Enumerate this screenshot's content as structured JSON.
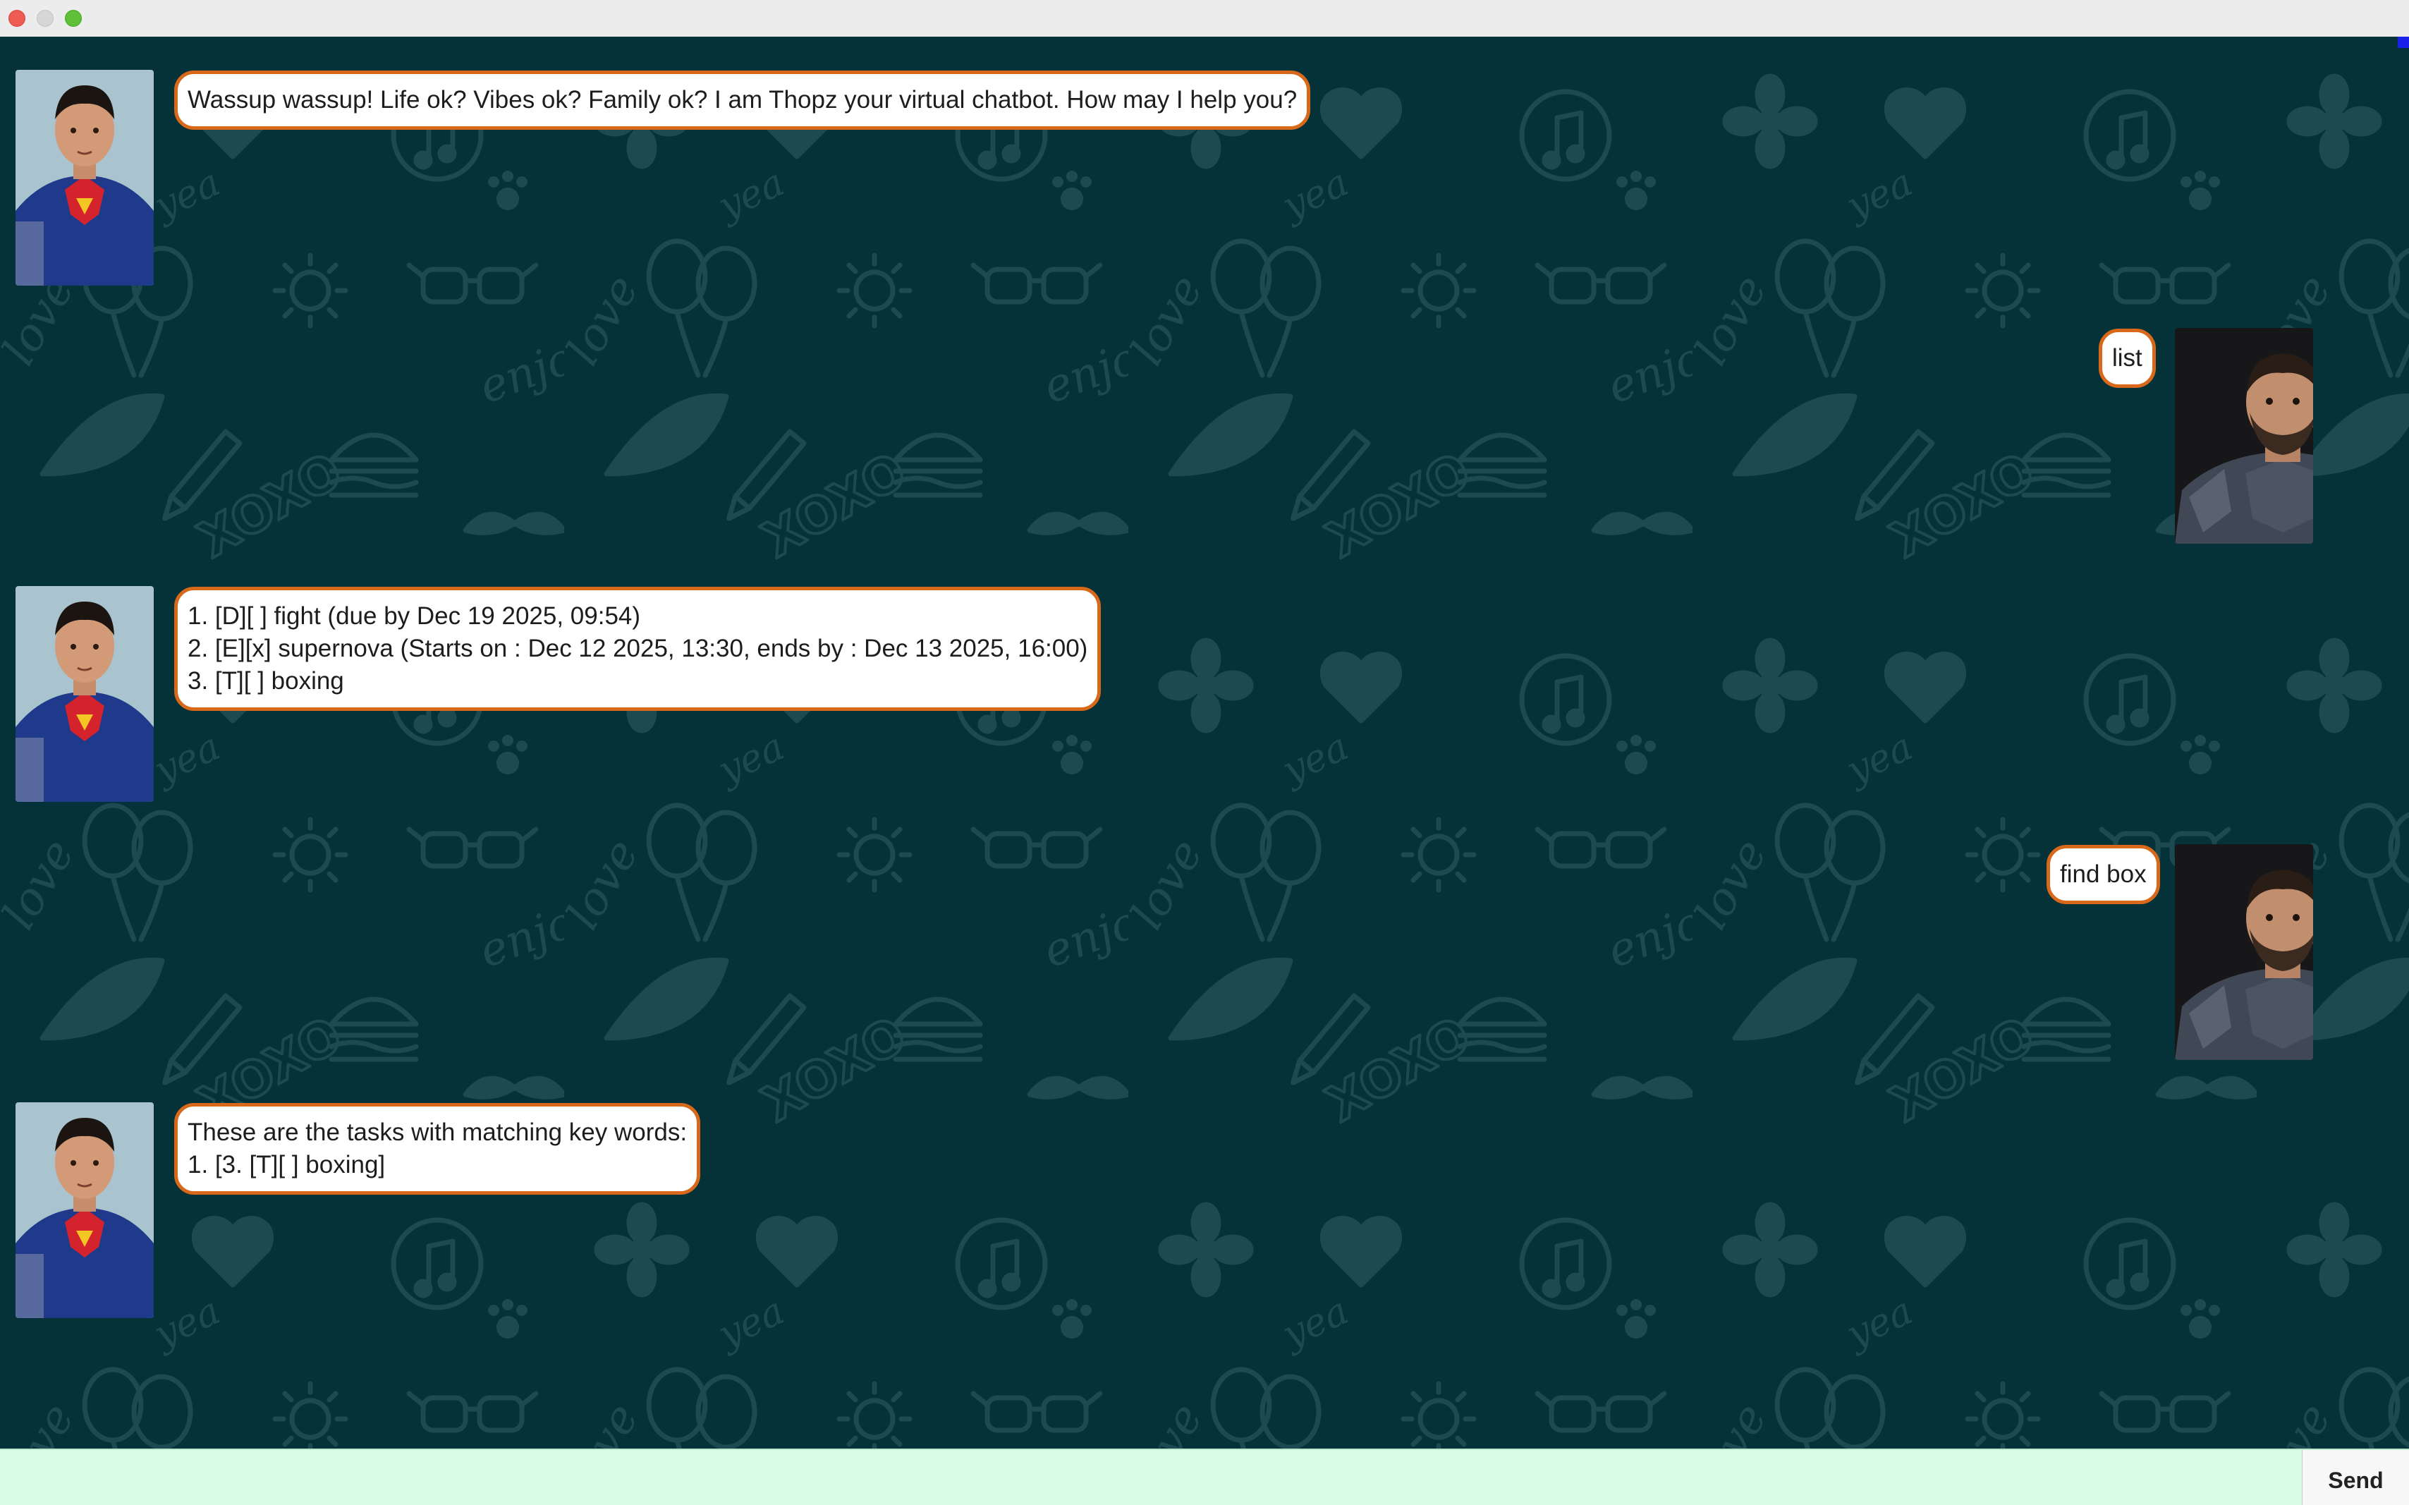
{
  "window": {
    "title": ""
  },
  "messages": [
    {
      "sender": "bot",
      "avatar": "bot-avatar-superhero",
      "lines": [
        "Wassup wassup! Life ok? Vibes ok? Family ok? I am Thopz your virtual chatbot. How may I help you?"
      ]
    },
    {
      "sender": "user",
      "avatar": "user-avatar-armored",
      "lines": [
        "list"
      ]
    },
    {
      "sender": "bot",
      "avatar": "bot-avatar-superhero",
      "lines": [
        "1. [D][ ] fight (due by Dec 19 2025, 09:54)",
        "2. [E][x] supernova (Starts on : Dec 12 2025, 13:30, ends by : Dec 13 2025, 16:00)",
        "3. [T][ ] boxing"
      ]
    },
    {
      "sender": "user",
      "avatar": "user-avatar-armored",
      "lines": [
        "find box"
      ]
    },
    {
      "sender": "bot",
      "avatar": "bot-avatar-superhero",
      "lines": [
        "These are the tasks with matching key words:",
        "1.  [3. [T][ ] boxing]"
      ]
    }
  ],
  "input": {
    "value": "",
    "placeholder": ""
  },
  "send_button": {
    "label": "Send"
  },
  "colors": {
    "background": "#043238",
    "bubble_border": "#d9691a",
    "bubble_fill": "#ffffff",
    "input_bar": "#d9fbe5",
    "close": "#ee5b52",
    "minimize": "#d6d6d6",
    "zoom": "#5fc038"
  }
}
